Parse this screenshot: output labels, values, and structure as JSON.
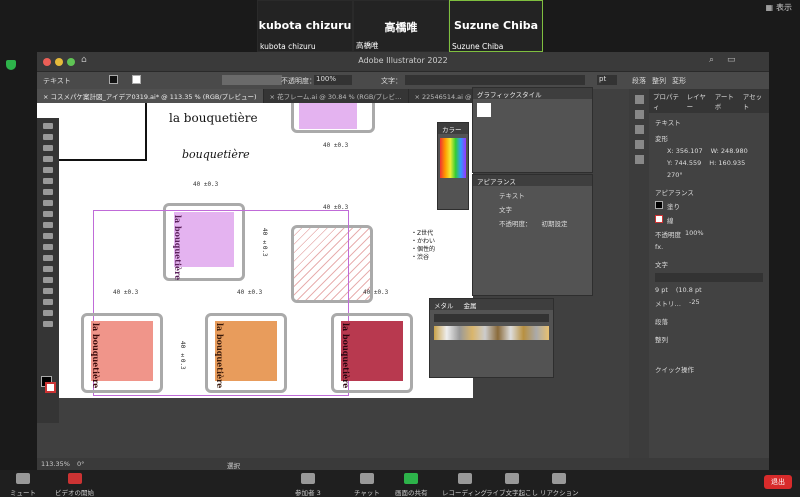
{
  "zoom": {
    "view_label": "表示",
    "participants": [
      {
        "name": "kubota chizuru",
        "label": "kubota chizuru"
      },
      {
        "name": "高橋唯",
        "label": "高橋唯"
      },
      {
        "name": "Suzune Chiba",
        "label": "Suzune Chiba"
      }
    ],
    "bottom": {
      "mute": "ミュート",
      "video": "ビデオの開始",
      "participants": "参加者",
      "participants_count": "3",
      "chat": "チャット",
      "share": "画面の共有",
      "record": "レコーディング",
      "captions": "ライブ文字起こし",
      "reactions": "リアクション",
      "leave": "退出"
    }
  },
  "illustrator": {
    "title": "Adobe Illustrator 2022",
    "toolbar": {
      "label": "テキスト",
      "opacity_label": "不透明度：",
      "opacity_value": "100%",
      "text_label": "文字：",
      "pt_value": "pt",
      "paragraph": "段落",
      "align": "整列",
      "transform": "変形"
    },
    "tabs": [
      "コスメパケ案計図_アイデア0319.ai* @ 113.35 % (RGB/プレビュー)",
      "花フレーム.ai @ 30.84 % (RGB/プレビ…",
      "22546514.ai @ 30.19 % (RGB/プレビ…"
    ],
    "canvas": {
      "brand_title": "la bouquetière",
      "brand_script": "bouquetière",
      "dims": [
        "40 ±0.3",
        "40 ±0.3",
        "40 ±0.3",
        "40 ±0.3",
        "40 ±0.3",
        "40 ±0.3",
        "40 ±0.3"
      ],
      "dim_vertical": "40 ±0.3",
      "bullets": [
        "・Z世代",
        "・かわい",
        "・個性的",
        "・渋谷"
      ],
      "vertical_brand": "la bouquetière",
      "colors": [
        "#e4b3f0",
        "#f0958a",
        "#e89c5c",
        "#b8394f",
        "#e8b4ec"
      ]
    },
    "panels": {
      "graphic_styles": "グラフィックスタイル",
      "color": "カラー",
      "appearance": "アピアランス",
      "appearance_text": "テキスト",
      "appearance_char": "文字",
      "appearance_opacity": "不透明度：",
      "appearance_opacity_value": "初期設定",
      "swatch_tab1": "メタル",
      "swatch_tab2": "金属"
    },
    "properties": {
      "tabs": [
        "プロパティ",
        "レイヤー",
        "アートボ",
        "アセット"
      ],
      "type_label": "テキスト",
      "transform_label": "変形",
      "x": "356.107",
      "y": "744.559",
      "w": "248.980",
      "h": "160.935",
      "angle": "270°",
      "appearance_label": "アピアランス",
      "fill": "塗り",
      "stroke": "線",
      "opacity_label": "不透明度",
      "opacity": "100%",
      "fx": "fx.",
      "character_label": "文字",
      "font_size": "9 pt",
      "leading": "(10.8 pt",
      "kerning": "メトリ…",
      "tracking": "-25",
      "paragraph_label": "段落",
      "align_label": "整列",
      "quick_label": "クイック操作"
    },
    "status": {
      "zoom": "113.35%",
      "angle": "0°",
      "selection": "選択"
    }
  }
}
